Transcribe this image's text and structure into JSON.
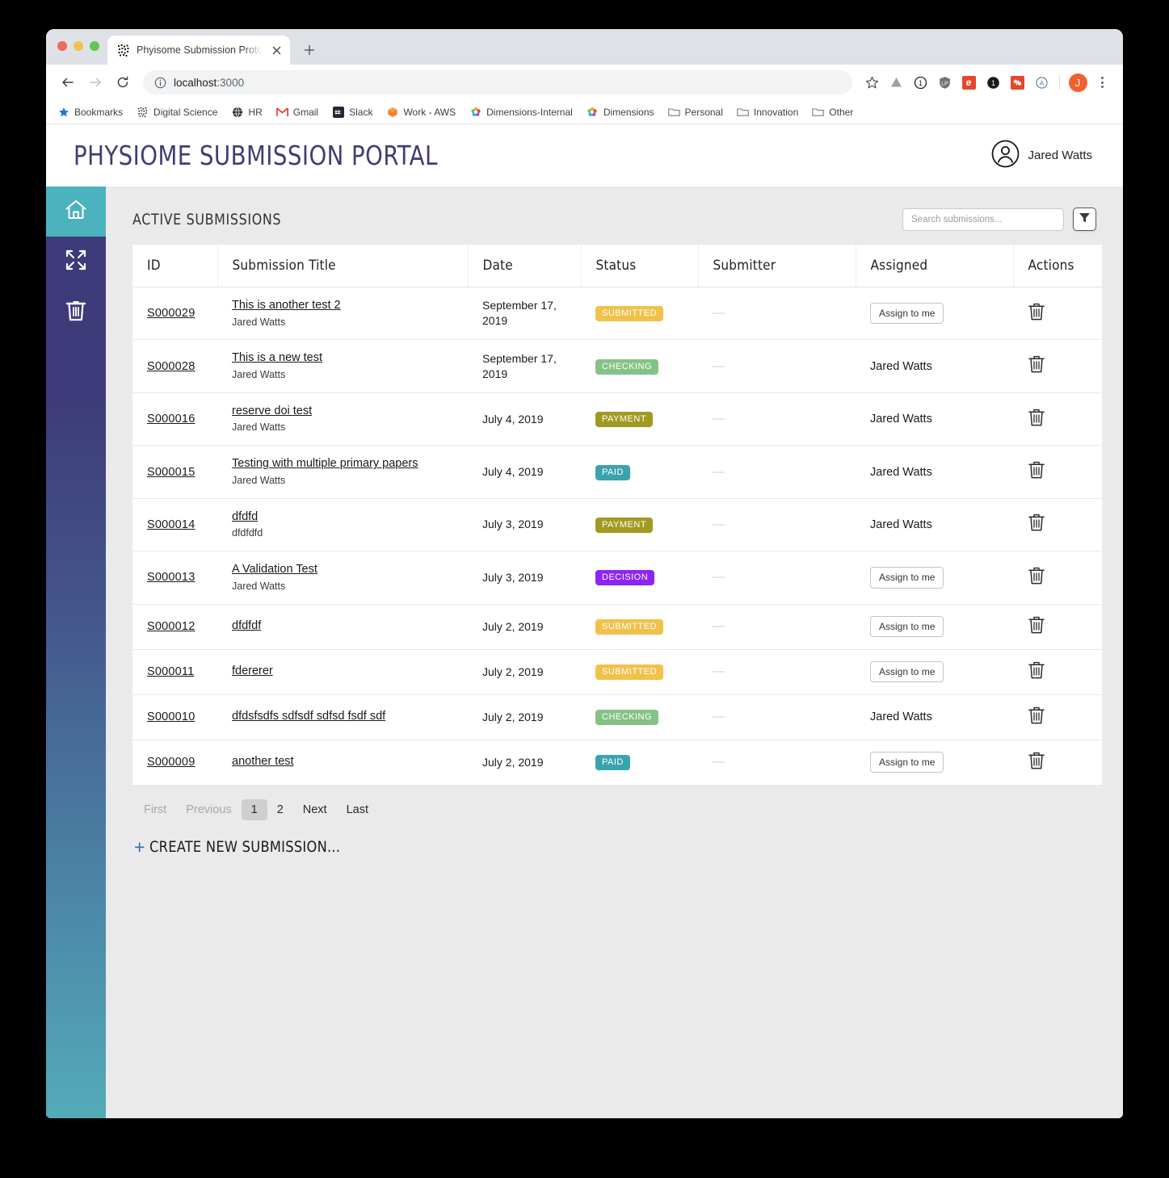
{
  "browser": {
    "tab": {
      "title": "Phyisome Submission Prototyp",
      "favicon": "physiome-dots-icon",
      "close": "×"
    },
    "new_tab_label": "+",
    "nav": {
      "back": "←",
      "forward": "→",
      "reload": "⟳"
    },
    "omnibox": {
      "host": "localhost",
      "port": ":3000",
      "info_icon": "site-info-icon"
    },
    "toolbar_icons": [
      {
        "name": "bookmark-star-icon",
        "glyph": "☆"
      },
      {
        "name": "google-drive-icon",
        "glyph": "▲"
      },
      {
        "name": "one-password-icon",
        "glyph": "①"
      },
      {
        "name": "lastpass-shield-icon",
        "glyph": "LP"
      },
      {
        "name": "evernote-icon",
        "glyph": "e"
      },
      {
        "name": "pocket-icon",
        "glyph": "❶"
      },
      {
        "name": "honey-icon",
        "glyph": "🐝"
      },
      {
        "name": "grammarly-icon",
        "glyph": "A"
      }
    ],
    "profile_initial": "J",
    "menu_icon": "kebab-menu-icon",
    "bookmarks": [
      {
        "label": "Bookmarks",
        "icon": "star-icon"
      },
      {
        "label": "Digital Science",
        "icon": "digital-science-icon"
      },
      {
        "label": "HR",
        "icon": "globe-icon"
      },
      {
        "label": "Gmail",
        "icon": "gmail-icon"
      },
      {
        "label": "Slack",
        "icon": "slack-icon"
      },
      {
        "label": "Work - AWS",
        "icon": "aws-cube-icon"
      },
      {
        "label": "Dimensions-Internal",
        "icon": "dimensions-icon"
      },
      {
        "label": "Dimensions",
        "icon": "dimensions-icon"
      },
      {
        "label": "Personal",
        "icon": "folder-icon"
      },
      {
        "label": "Innovation",
        "icon": "folder-icon"
      },
      {
        "label": "Other",
        "icon": "folder-icon"
      }
    ]
  },
  "app": {
    "title": "PHYSIOME SUBMISSION PORTAL",
    "user": {
      "name": "Jared Watts",
      "avatar_icon": "user-circle-icon"
    },
    "sidebar": [
      {
        "name": "home",
        "icon": "home-icon",
        "active": true
      },
      {
        "name": "expand",
        "icon": "expand-arrows-icon",
        "active": false
      },
      {
        "name": "trash",
        "icon": "trash-icon",
        "active": false
      }
    ],
    "section_title": "ACTIVE SUBMISSIONS",
    "search": {
      "placeholder": "Search submissions...",
      "value": ""
    },
    "filter_button": {
      "name": "filter-icon",
      "label": ""
    },
    "table": {
      "columns": [
        "ID",
        "Submission Title",
        "Date",
        "Status",
        "Submitter",
        "Assigned",
        "Actions"
      ],
      "rows": [
        {
          "id": "S000029",
          "title": "This is another test 2",
          "subtitle": "Jared Watts",
          "date": "September 17, 2019",
          "status": "SUBMITTED",
          "status_color": "#f0c14b",
          "submitter": "—",
          "assigned": "",
          "assign_button": "Assign to me",
          "action_icon": "trash-icon"
        },
        {
          "id": "S000028",
          "title": "This is a new test",
          "subtitle": "Jared Watts",
          "date": "September 17, 2019",
          "status": "CHECKING",
          "status_color": "#85c285",
          "submitter": "—",
          "assigned": "Jared Watts",
          "assign_button": "",
          "action_icon": "trash-icon"
        },
        {
          "id": "S000016",
          "title": "reserve doi test",
          "subtitle": "Jared Watts",
          "date": "July 4, 2019",
          "status": "PAYMENT",
          "status_color": "#a09a23",
          "submitter": "—",
          "assigned": "Jared Watts",
          "assign_button": "",
          "action_icon": "trash-icon"
        },
        {
          "id": "S000015",
          "title": "Testing with multiple primary papers",
          "subtitle": "Jared Watts",
          "date": "July 4, 2019",
          "status": "PAID",
          "status_color": "#3ba3ae",
          "submitter": "—",
          "assigned": "Jared Watts",
          "assign_button": "",
          "action_icon": "trash-icon"
        },
        {
          "id": "S000014",
          "title": "dfdfd",
          "subtitle": "dfdfdfd",
          "date": "July 3, 2019",
          "status": "PAYMENT",
          "status_color": "#a09a23",
          "submitter": "—",
          "assigned": "Jared Watts",
          "assign_button": "",
          "action_icon": "trash-icon"
        },
        {
          "id": "S000013",
          "title": "A Validation Test",
          "subtitle": "Jared Watts",
          "date": "July 3, 2019",
          "status": "DECISION",
          "status_color": "#8d24f5",
          "submitter": "—",
          "assigned": "",
          "assign_button": "Assign to me",
          "action_icon": "trash-icon"
        },
        {
          "id": "S000012",
          "title": "dfdfdf",
          "subtitle": "",
          "date": "July 2, 2019",
          "status": "SUBMITTED",
          "status_color": "#f0c14b",
          "submitter": "—",
          "assigned": "",
          "assign_button": "Assign to me",
          "action_icon": "trash-icon"
        },
        {
          "id": "S000011",
          "title": "fdererer",
          "subtitle": "",
          "date": "July 2, 2019",
          "status": "SUBMITTED",
          "status_color": "#f0c14b",
          "submitter": "—",
          "assigned": "",
          "assign_button": "Assign to me",
          "action_icon": "trash-icon"
        },
        {
          "id": "S000010",
          "title": "dfdsfsdfs sdfsdf sdfsd fsdf sdf",
          "subtitle": "",
          "date": "July 2, 2019",
          "status": "CHECKING",
          "status_color": "#85c285",
          "submitter": "—",
          "assigned": "Jared Watts",
          "assign_button": "",
          "action_icon": "trash-icon"
        },
        {
          "id": "S000009",
          "title": "another test",
          "subtitle": "",
          "date": "July 2, 2019",
          "status": "PAID",
          "status_color": "#3ba3ae",
          "submitter": "—",
          "assigned": "",
          "assign_button": "Assign to me",
          "action_icon": "trash-icon"
        }
      ]
    },
    "pagination": {
      "first": "First",
      "previous": "Previous",
      "pages": [
        "1",
        "2"
      ],
      "current_page": "1",
      "next": "Next",
      "last": "Last"
    },
    "create_link": {
      "plus": "+",
      "label": "CREATE NEW SUBMISSION..."
    }
  }
}
